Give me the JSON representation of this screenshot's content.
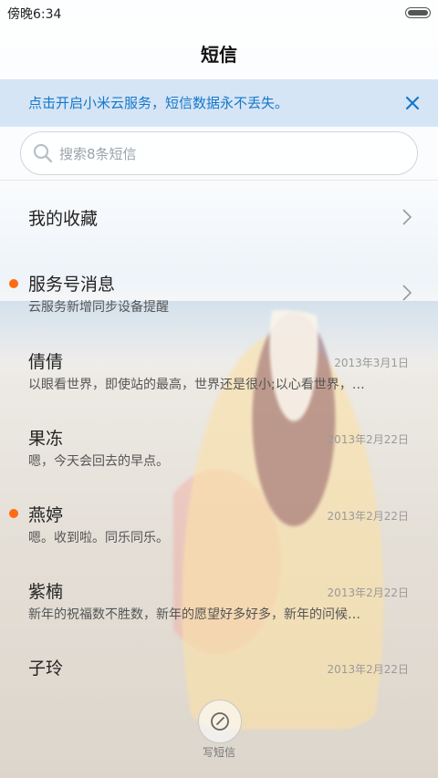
{
  "status_bar": {
    "time": "傍晚6:34"
  },
  "header": {
    "title": "短信"
  },
  "banner": {
    "text": "点击开启小米云服务，短信数据永不丢失。",
    "accent": "#1478c8"
  },
  "search": {
    "placeholder": "搜索8条短信"
  },
  "favorites": {
    "label": "我的收藏"
  },
  "service": {
    "name": "服务号消息",
    "preview": "云服务新增同步设备提醒",
    "unread_dot_color": "#ff6a13"
  },
  "messages": [
    {
      "name": "倩倩",
      "date": "2013年3月1日",
      "preview": "以眼看世界，即使站的最高，世界还是很小;以心看世界，…",
      "unread": false
    },
    {
      "name": "果冻",
      "date": "2013年2月22日",
      "preview": "嗯，今天会回去的早点。",
      "unread": false
    },
    {
      "name": "燕婷",
      "date": "2013年2月22日",
      "preview": "嗯。收到啦。同乐同乐。",
      "unread": true
    },
    {
      "name": "紫楠",
      "date": "2013年2月22日",
      "preview": "新年的祝福数不胜数，新年的愿望好多好多，新年的问候…",
      "unread": false
    },
    {
      "name": "子玲",
      "date": "2013年2月22日",
      "preview": "",
      "unread": false
    }
  ],
  "compose": {
    "label": "写短信"
  }
}
